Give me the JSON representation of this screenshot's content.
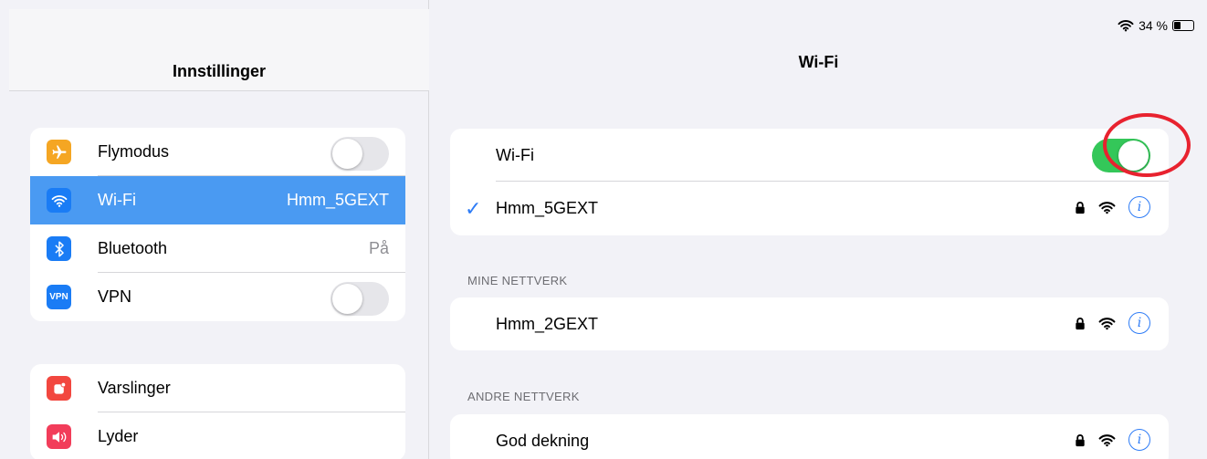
{
  "left": {
    "title": "Innstillinger",
    "group1": [
      {
        "label": "Flymodus",
        "icon": "airplane-icon",
        "color": "#f5a623",
        "control": "toggle-off"
      },
      {
        "label": "Wi-Fi",
        "icon": "wifi-icon",
        "color": "#1a7cf5",
        "value": "Hmm_5GEXT",
        "selected": true
      },
      {
        "label": "Bluetooth",
        "icon": "bluetooth-icon",
        "color": "#1a7cf5",
        "value": "På"
      },
      {
        "label": "VPN",
        "icon": "vpn-icon",
        "icon_text": "VPN",
        "color": "#1a7cf5",
        "control": "toggle-off"
      }
    ],
    "group2": [
      {
        "label": "Varslinger",
        "icon": "notifications-icon",
        "color": "#f2473f"
      },
      {
        "label": "Lyder",
        "icon": "sounds-icon",
        "color": "#f23d5a"
      }
    ]
  },
  "right": {
    "status": {
      "battery_text": "34 %"
    },
    "title": "Wi-Fi",
    "wifi_toggle_label": "Wi-Fi",
    "wifi_on": true,
    "connected_network": "Hmm_5GEXT",
    "my_networks_header": "MINE NETTVERK",
    "my_networks": [
      "Hmm_2GEXT"
    ],
    "other_networks_header": "ANDRE NETTVERK",
    "other_networks": [
      "God dekning"
    ]
  },
  "colors": {
    "accent": "#2e7cf6",
    "toggle_on": "#34c759",
    "highlight": "#e8222f",
    "selected_row": "#4a9af2"
  }
}
